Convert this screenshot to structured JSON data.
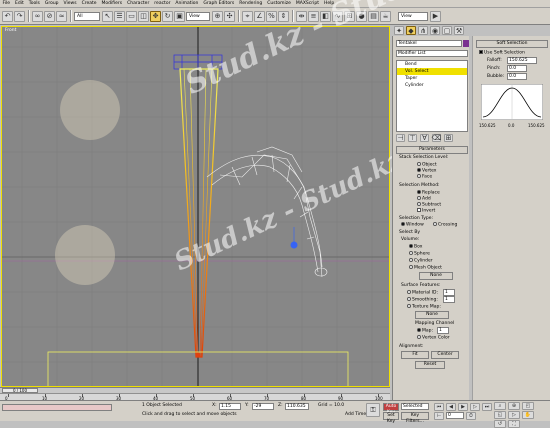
{
  "menu": [
    "File",
    "Edit",
    "Tools",
    "Group",
    "Views",
    "Create",
    "Modifiers",
    "Character",
    "reactor",
    "Animation",
    "Graph Editors",
    "Rendering",
    "Customize",
    "MAXScript",
    "Help"
  ],
  "toolbar": {
    "filter_value": "All",
    "refcoord_value": "View",
    "named_sel_value": "View"
  },
  "viewport": {
    "label": "Front"
  },
  "command_panel": {
    "object_name": "Tentakel",
    "modifier_list": "Modifier List",
    "stack": [
      "Bend",
      "Vol. Select",
      "Taper",
      "Cylinder"
    ],
    "rollout_title": "Parameters",
    "stack_selection_level": "Stack Selection Level:",
    "level_options": [
      "Object",
      "Vertex",
      "Face"
    ],
    "selection_method": "Selection Method:",
    "method_options": [
      "Replace",
      "Add",
      "Subtract",
      "Invert"
    ],
    "selection_type": "Selection Type:",
    "type_options": [
      "Window",
      "Crossing"
    ],
    "select_by": "Select By",
    "volume": "Volume:",
    "volume_options": [
      "Box",
      "Sphere",
      "Cylinder",
      "Mesh Object"
    ],
    "none_button": "None",
    "surface_features": "Surface Features:",
    "surface_options": [
      "Material ID:",
      "Smoothing:",
      "Texture Map:"
    ],
    "material_id_value": "1",
    "smoothing_value": "1",
    "none_button2": "None",
    "mapping_channel": "Mapping Channel",
    "map_label": "Map:",
    "map_value": "1",
    "vertex_color": "Vertex Color",
    "alignment": "Alignment:",
    "fit_button": "Fit",
    "center_button": "Center",
    "reset_button": "Reset"
  },
  "soft_selection": {
    "title": "Soft Selection",
    "use_soft": "Use Soft Selection",
    "falloff_label": "Falloff:",
    "falloff_value": "150.625",
    "pinch_label": "Pinch:",
    "pinch_value": "0.0",
    "bubble_label": "Bubble:",
    "bubble_value": "0.0",
    "curve_labels": [
      "150.625",
      "0.0",
      "150.625"
    ]
  },
  "timeline": {
    "frame_counter": "0 / 100",
    "ticks": [
      "0",
      "10",
      "20",
      "30",
      "40",
      "50",
      "60",
      "70",
      "80",
      "90",
      "100"
    ]
  },
  "status": {
    "selected": "1 Object Selected",
    "prompt": "Click and drag to select and move objects",
    "x_label": "X:",
    "x_value": "1.15",
    "y_label": "Y:",
    "y_value": "-29",
    "z_label": "Z:",
    "z_value": "110.635",
    "grid": "Grid = 10.0",
    "auto_key": "Auto Key",
    "selected_dd": "Selected",
    "set_key": "Set Key",
    "key_filters": "Key Filters...",
    "add_time_tag": "Add Time Tag",
    "frame": "0"
  },
  "watermark": "Stud.kz - Stud.kz"
}
